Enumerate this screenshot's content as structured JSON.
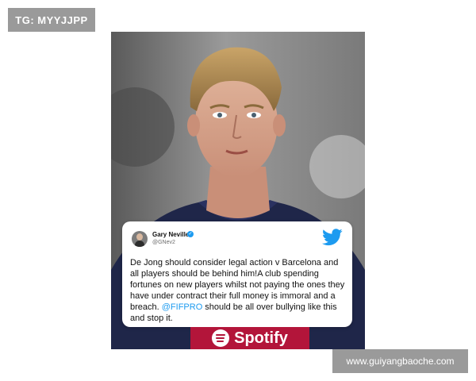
{
  "badge": {
    "text": "TG: MYYJJPP"
  },
  "tweet": {
    "author_name": "Gary Neville",
    "author_handle": "@GNev2",
    "text_before_mention": "De Jong should consider legal action v Barcelona and all players should be behind him!A club spending fortunes on new players whilst not paying the ones they have under contract their full money is immoral and a breach. ",
    "mention": "@FIFPRO",
    "text_after_mention": " should be all over bullying like this and stop it."
  },
  "jersey": {
    "sponsor": "Spotify"
  },
  "watermark": {
    "text": "www.guiyangbaoche.com"
  },
  "colors": {
    "twitter_blue": "#1d9bf0",
    "jersey_navy": "#1f2649",
    "jersey_red": "#b3153a",
    "badge_gray": "#9a9a9a"
  }
}
